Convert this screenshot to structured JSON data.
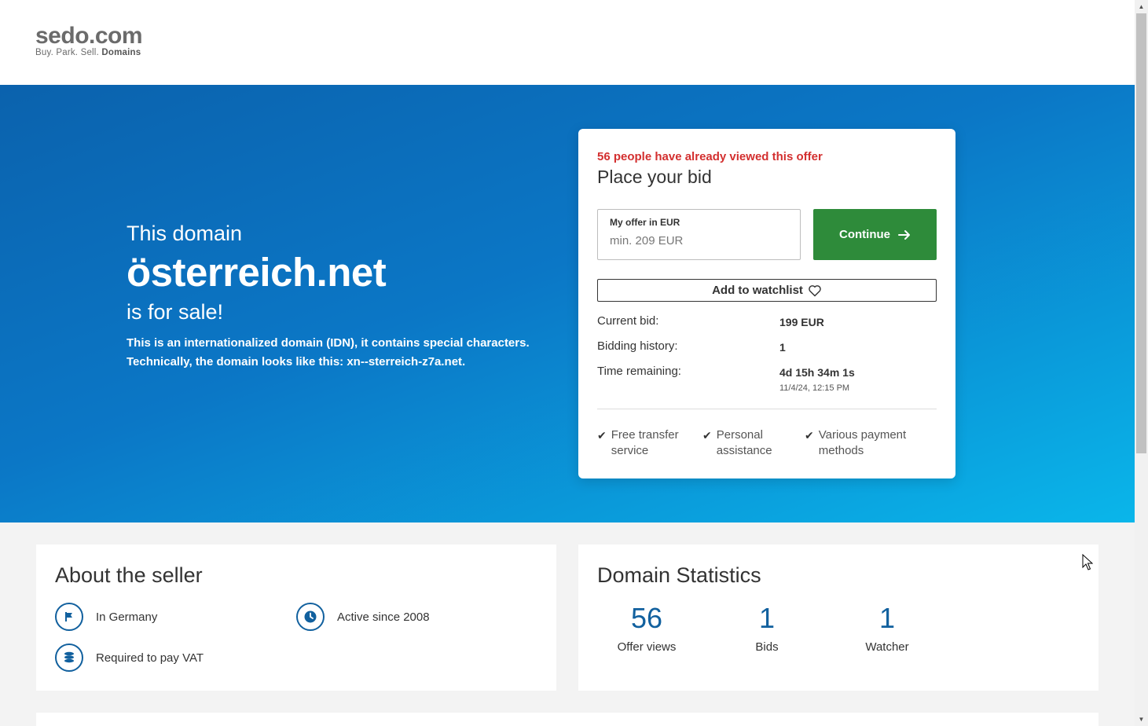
{
  "header": {
    "logo_main": "sedo.com",
    "logo_tag_prefix": "Buy.  Park.  Sell.",
    "logo_tag_bold": "Domains"
  },
  "hero": {
    "pre": "This domain",
    "domain": "österreich.net",
    "post": "is for sale!",
    "idn_line1": "This is an internationalized domain (IDN), it contains special characters.",
    "idn_line2": "Technically, the domain looks like this: xn--sterreich-z7a.net."
  },
  "bid": {
    "views_alert": "56 people have already viewed this offer",
    "title": "Place your bid",
    "offer_label": "My offer in EUR",
    "offer_placeholder": "min. 209 EUR",
    "continue_label": "Continue",
    "watchlist_label": "Add to watchlist",
    "current_bid_label": "Current bid:",
    "current_bid_value": "199 EUR",
    "history_label": "Bidding history:",
    "history_value": "1",
    "time_label": "Time remaining:",
    "time_value": "4d 15h 34m 1s",
    "time_end": "11/4/24, 12:15 PM",
    "features": [
      "Free transfer service",
      "Personal assistance",
      "Various payment methods"
    ]
  },
  "seller": {
    "title": "About the seller",
    "location": "In Germany",
    "active_since": "Active since 2008",
    "vat": "Required to pay VAT"
  },
  "stats": {
    "title": "Domain Statistics",
    "items": [
      {
        "value": "56",
        "label": "Offer views"
      },
      {
        "value": "1",
        "label": "Bids"
      },
      {
        "value": "1",
        "label": "Watcher"
      }
    ]
  },
  "colors": {
    "accent_blue": "#11609e",
    "cta_green": "#2e8b3a",
    "alert_red": "#d32f2f",
    "hero_start": "#0b62ad",
    "hero_end": "#0ab6ea"
  },
  "icons": [
    "flag-icon",
    "clock-icon",
    "coins-icon",
    "heart-icon",
    "arrow-right-icon",
    "check-icon"
  ]
}
